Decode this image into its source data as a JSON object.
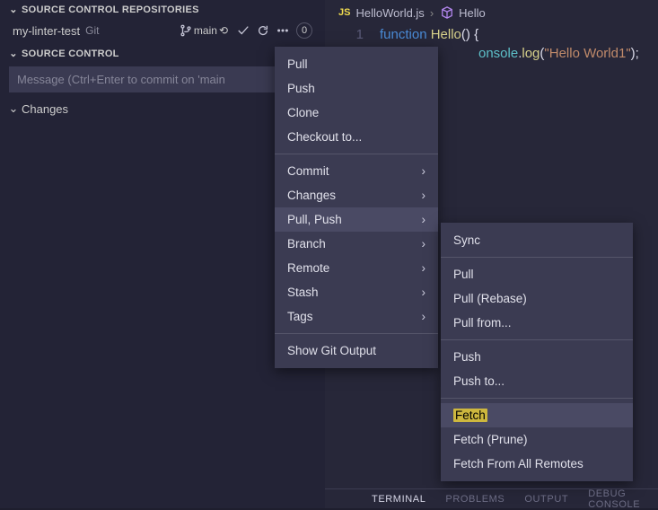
{
  "sidebar": {
    "repos_header": "SOURCE CONTROL REPOSITORIES",
    "repo": {
      "name": "my-linter-test",
      "vcs": "Git",
      "branch": "main",
      "sync_glyph": "⟲",
      "badge": "0"
    },
    "sc_header": "SOURCE CONTROL",
    "commit_placeholder": "Message (Ctrl+Enter to commit on 'main",
    "changes_label": "Changes"
  },
  "editor": {
    "tab_file": "HelloWorld.js",
    "crumb_symbol": "Hello",
    "line_no": "1",
    "code": {
      "kw": "function",
      "fn": "Hello",
      "parens": "()",
      "brace": " {",
      "obj": "onsole",
      "dot": ".",
      "call": "log",
      "open": "(",
      "str": "\"Hello World1\"",
      "close": ");"
    }
  },
  "menu1": {
    "pull": "Pull",
    "push": "Push",
    "clone": "Clone",
    "checkout": "Checkout to...",
    "commit": "Commit",
    "changes": "Changes",
    "pullpush": "Pull, Push",
    "branch": "Branch",
    "remote": "Remote",
    "stash": "Stash",
    "tags": "Tags",
    "showgit": "Show Git Output"
  },
  "menu2": {
    "sync": "Sync",
    "pull": "Pull",
    "pullrebase": "Pull (Rebase)",
    "pullfrom": "Pull from...",
    "push": "Push",
    "pushto": "Push to...",
    "fetch": "Fetch",
    "fetchprune": "Fetch (Prune)",
    "fetchall": "Fetch From All Remotes"
  },
  "bottom": {
    "terminal": "TERMINAL",
    "problems": "PROBLEMS",
    "output": "OUTPUT",
    "debug": "DEBUG CONSOLE"
  }
}
